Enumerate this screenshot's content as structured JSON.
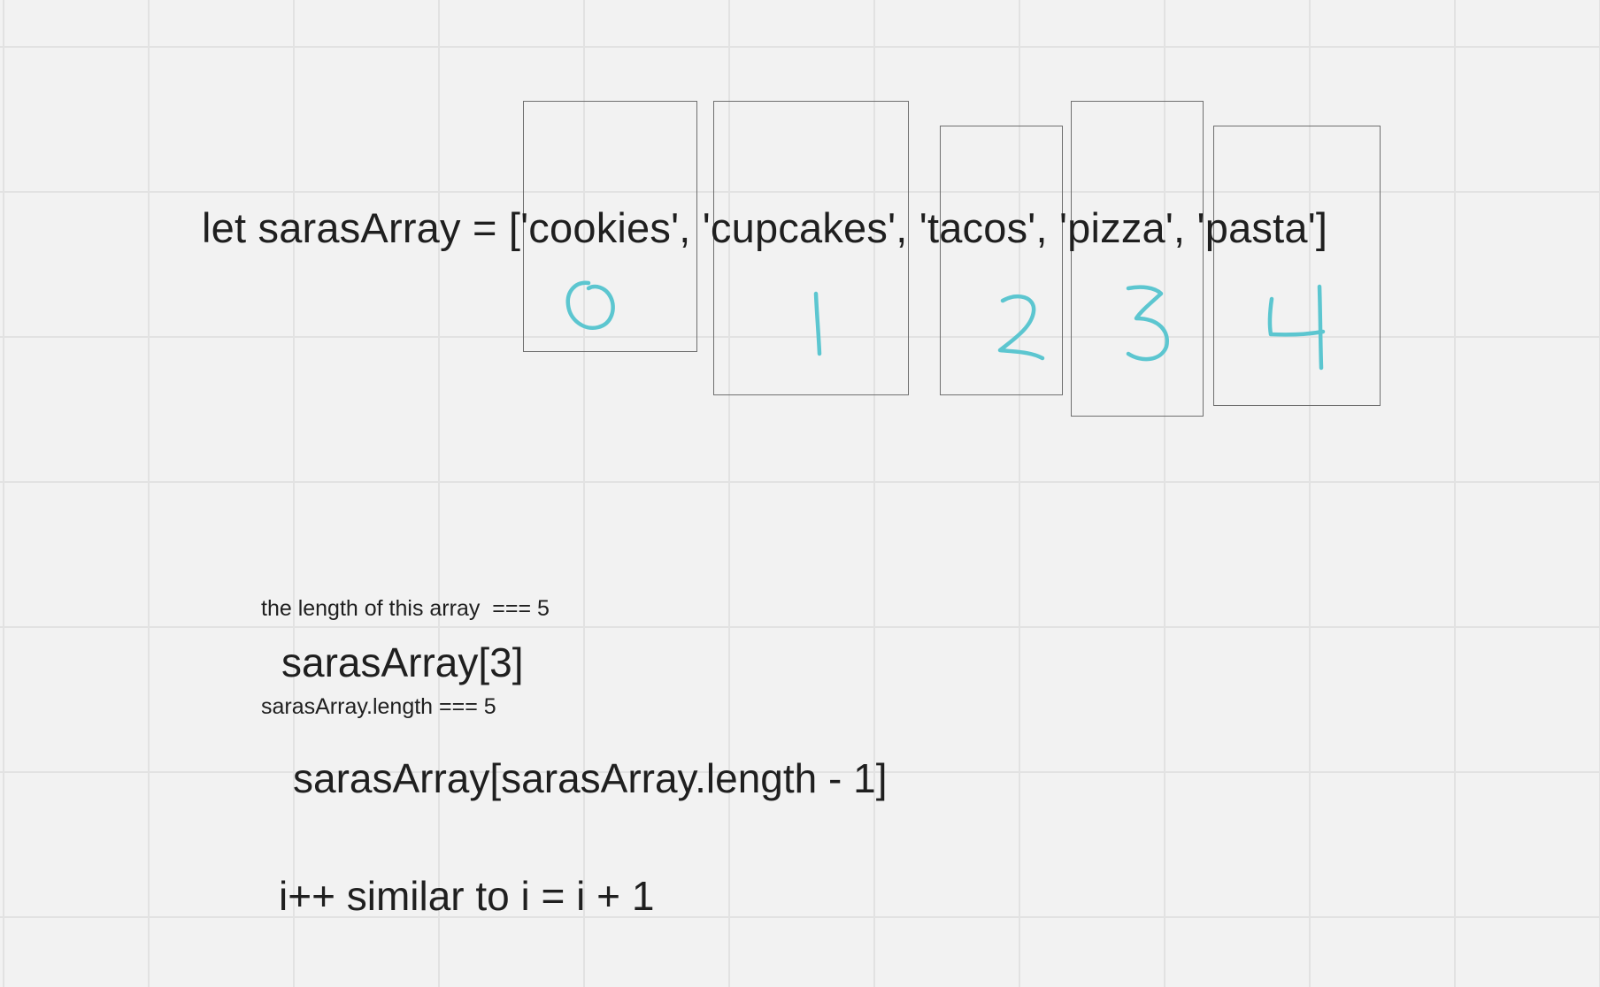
{
  "board": {
    "code_line": "let sarasArray = ['cookies', 'cupcakes', 'tacos', 'pizza', 'pasta']",
    "notes": {
      "line1": "the length of this array  === 5",
      "line2": "sarasArray.length === 5"
    },
    "expressions": {
      "index_access": "sarasArray[3]",
      "last_item": "sarasArray[sarasArray.length - 1]",
      "increment": "i++ similar to i = i + 1"
    },
    "index_labels": [
      "0",
      "1",
      "2",
      "3",
      "4"
    ],
    "colors": {
      "background": "#f2f2f2",
      "grid": "#e2e2e2",
      "text": "#1f1f1f",
      "box_border": "#6f6f6f",
      "handwriting": "#5cc6d0"
    }
  }
}
